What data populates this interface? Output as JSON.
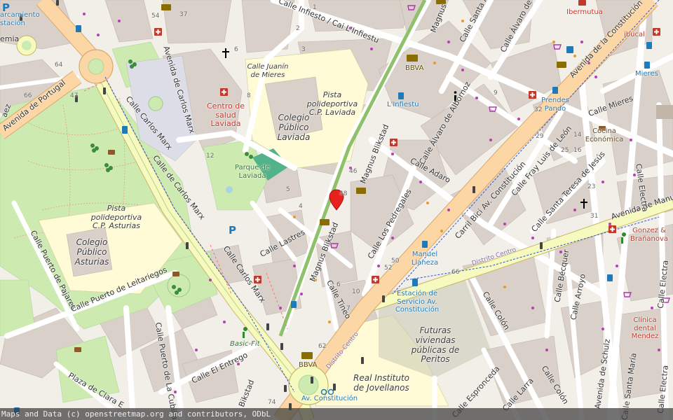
{
  "attribution": "Maps and Data (c) openstreetmap.org and contributors, ODbL",
  "pin_icon": "location-pin-icon",
  "colors": {
    "land": "#f2efe9",
    "building": "#d9d0c9",
    "park": "#cdebb0",
    "school": "#fefbd6",
    "primary_road": "#fcd6a4",
    "secondary_road": "#f7fabf",
    "footway": "#fa8072",
    "pin": "#e8211c",
    "green_block": "#52b38a"
  },
  "streets": {
    "carlos_marx_1": "Calle Carlos Marx",
    "carlos_marx_2": "Calle de Carlos Marx",
    "carlos_marx_3": "Calle Carlos Marx",
    "av_carlos_marx": "Avenida de Carlos Marx",
    "av_portugal": "Avenida de Portugal",
    "infiesto": "Calle Infiesto / Cai L'Infiestu",
    "magnus_1": "Magnus Blikstad",
    "magnus_2": "Magnus Blikstad",
    "magnus_3": "Magnus",
    "magnus_4": "Bikstad",
    "alvaro_1": "Calle Álvaro de Alb",
    "alvaro_2": "Calle Álvaro de Albornoz",
    "santa_an": "Calle Santa An",
    "av_constitucion": "Avenida de la Constitución",
    "adaro": "Calle Adaro",
    "mieres": "Calle Mieres",
    "fray_luis": "Calle Fray Luis de León",
    "teresa": "Calle Santa Teresa de Jesús",
    "carril_bici": "Carril Bici Av. Constitución",
    "av_manuel": "Avenida de Manu",
    "pedregales": "Calle Los Pedregales",
    "lastres": "Calle Lastres",
    "tineo": "Calle Tineo",
    "colon_1": "Calle Colón",
    "colon_2": "Calle Colón",
    "becquer": "Calle Bécquer",
    "arroyo": "Calle Arroyo",
    "schulz": "Avenida de Schulz",
    "santa_maria": "Calle Santa María",
    "electra_1": "Calle Electra",
    "electra_2": "Calle Electra",
    "electra_3": "Calle Electra",
    "puerto_pajares": "Calle Puerto de Pajares",
    "puerto_leitariegos": "Calle Puerto de Leitariegos",
    "puerto_cubilla": "Calle Puerto de La Cubilla",
    "el_entrego": "Calle El Entrego",
    "plaza_clara": "Plaza de Clara E",
    "espronceda": "Calle Espronceda",
    "larra": "Calle Larra",
    "distrito_centro_1": "Distrito Centro",
    "distrito_centro_2": "Distrito Centro",
    "juanin": "Calle Juanín de Mieres",
    "edge_emia": "emia",
    "edge_aez": "aez"
  },
  "pois": {
    "centro_salud": "Centro de salud Laviada",
    "colegio_laviada": "Colegio Público Laviada",
    "pista_laviada": "Pista polideportiva C.P. Laviada",
    "parque_laviada": "Parque de Laviada",
    "pista_asturias": "Pista polideportiva C.P. Asturias",
    "colegio_asturias": "Colegio Público Asturias",
    "futuras": "Futuras viviendas públicas de Peritos",
    "real_instituto": "Real Instituto de Jovellanos",
    "estacion": "Estación de Servicio Av. Constitución",
    "bbva_1": "BBVA",
    "bbva_2": "BBVA",
    "linfiestu": "L'Infiestu",
    "prendes": "Prendes Pando",
    "cocina": "Cocina Económica",
    "ibermutua": "Ibermutua",
    "ibucal": "ibucal",
    "mieres_stop": "Mieres",
    "manuel_llaneza": "Manuel Llaneza",
    "gonzez": "Gonzez & Brañanova",
    "clinica": "Clínica dental Mendez",
    "basic_fit": "Basic-Fit",
    "av_constitucion_bike": "Av. Constitución",
    "aparcamiento": "arcamiento stación"
  },
  "numbers": {
    "n54": "54",
    "n37": "37",
    "n6": "6",
    "n3": "3",
    "n1": "1",
    "n2": "2",
    "n4": "4",
    "n5": "5",
    "n8": "8",
    "n12": "12",
    "n64": "64",
    "n66": "66",
    "n47": "47",
    "n46": "46",
    "n48": "48",
    "n9": "9",
    "n52": "52",
    "n50": "50",
    "n10": "10",
    "n62": "62",
    "n74": "74",
    "n29": "29",
    "n25": "25",
    "n14": "14",
    "n16": "16",
    "n23": "23",
    "n31": "31",
    "n32": "32",
    "n7": "7",
    "n6b": "6"
  }
}
